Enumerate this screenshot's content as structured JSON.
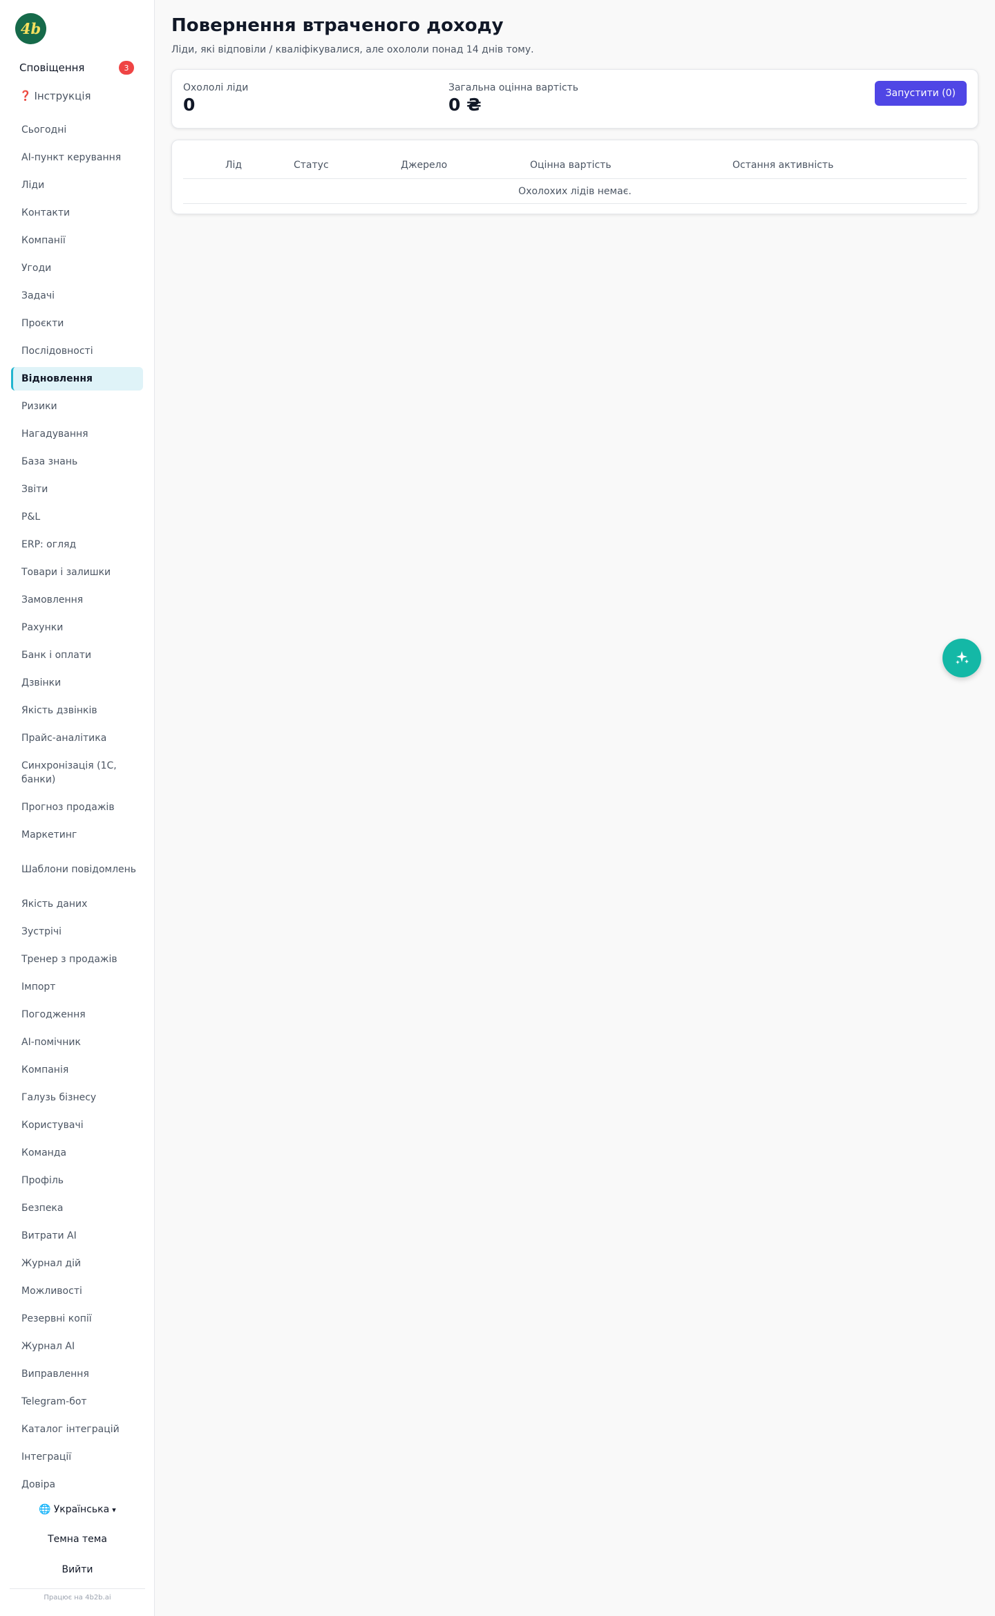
{
  "sidebar": {
    "notifications": {
      "label": "Сповіщення",
      "count": "3"
    },
    "instructions": {
      "icon": "❓",
      "label": "Інструкція"
    },
    "items": [
      {
        "label": "Сьогодні"
      },
      {
        "label": "AI-пункт керування"
      },
      {
        "label": "Ліди"
      },
      {
        "label": "Контакти"
      },
      {
        "label": "Компанії"
      },
      {
        "label": "Угоди"
      },
      {
        "label": "Задачі"
      },
      {
        "label": "Проєкти"
      },
      {
        "label": "Послідовності"
      },
      {
        "label": "Відновлення",
        "active": true
      },
      {
        "label": "Ризики"
      },
      {
        "label": "Нагадування"
      },
      {
        "label": "База знань"
      },
      {
        "label": "Звіти"
      },
      {
        "label": "P&L"
      },
      {
        "label": "ERP: огляд"
      },
      {
        "label": "Товари і залишки"
      },
      {
        "label": "Замовлення"
      },
      {
        "label": "Рахунки"
      },
      {
        "label": "Банк і оплати"
      },
      {
        "label": "Дзвінки"
      },
      {
        "label": "Якість дзвінків"
      },
      {
        "label": "Прайс-аналітика"
      },
      {
        "label": "Синхронізація (1С, банки)"
      },
      {
        "label": "Прогноз продажів"
      },
      {
        "label": "Маркетинг"
      },
      {
        "label": "Шаблони повідомлень"
      },
      {
        "label": "Якість даних"
      },
      {
        "label": "Зустрічі"
      },
      {
        "label": "Тренер з продажів"
      },
      {
        "label": "Імпорт"
      },
      {
        "label": "Погодження"
      },
      {
        "label": "AI-помічник"
      },
      {
        "label": "Компанія"
      },
      {
        "label": "Галузь бізнесу"
      },
      {
        "label": "Користувачі"
      },
      {
        "label": "Команда"
      },
      {
        "label": "Профіль"
      },
      {
        "label": "Безпека"
      },
      {
        "label": "Витрати AI"
      },
      {
        "label": "Журнал дій"
      },
      {
        "label": "Можливості"
      },
      {
        "label": "Резервні копії"
      },
      {
        "label": "Журнал AI"
      },
      {
        "label": "Виправлення"
      },
      {
        "label": "Telegram-бот"
      },
      {
        "label": "Каталог інтеграцій"
      },
      {
        "label": "Інтеграції"
      },
      {
        "label": "Довіра"
      }
    ],
    "language": {
      "icon": "🌐",
      "label": "Українська",
      "caret": "▾"
    },
    "theme_label": "Темна тема",
    "logout_label": "Вийти",
    "powered_by": "Працює на 4b2b.ai",
    "logo_text": "4b"
  },
  "main": {
    "title": "Повернення втраченого доходу",
    "subtitle": "Ліди, які відповіли / кваліфікувалися, але охололи понад 14 днів тому.",
    "stats": {
      "cold_leads_label": "Охололі ліди",
      "cold_leads_value": "0",
      "total_value_label": "Загальна оцінна вартість",
      "total_value_value": "0 ₴"
    },
    "run_button_label": "Запустити (0)",
    "table": {
      "columns": [
        "Лід",
        "Статус",
        "Джерело",
        "Оцінна вартість",
        "Остання активність"
      ],
      "empty_text": "Охолохих лідів немає."
    }
  },
  "colors": {
    "accent": "#4f46e5",
    "active_nav_bg": "#dff3f8",
    "active_nav_border": "#22b5cf",
    "badge": "#ef4444",
    "fab": "#14b8a6",
    "logo_bg": "#166a4a"
  },
  "fab_icon": "sparkles-icon"
}
